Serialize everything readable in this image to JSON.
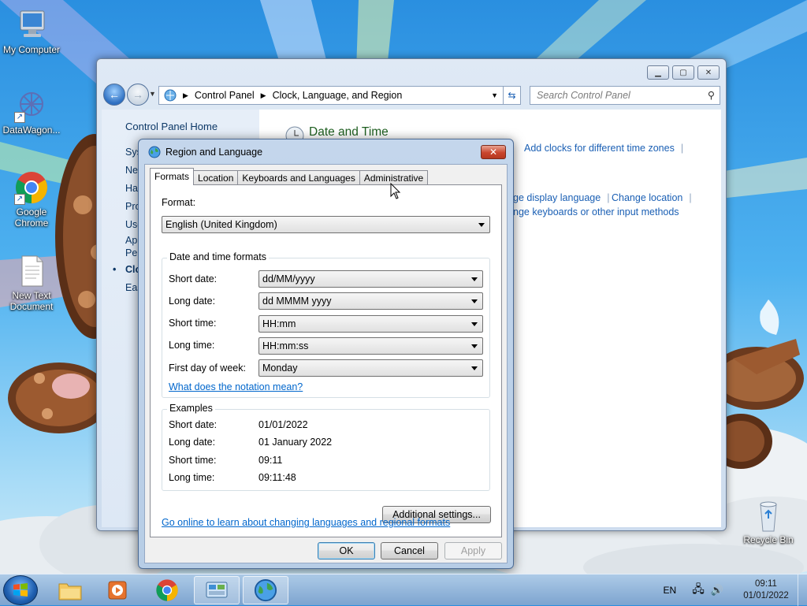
{
  "desktop": {
    "icons": [
      {
        "label": "My Computer"
      },
      {
        "label": "DataWagon..."
      },
      {
        "label": "Google Chrome"
      },
      {
        "label": "New Text Document"
      },
      {
        "label": "Recycle Bin"
      }
    ]
  },
  "control_panel": {
    "breadcrumb": [
      "Control Panel",
      "Clock, Language, and Region"
    ],
    "search_placeholder": "Search Control Panel",
    "left_nav": {
      "home": "Control Panel Home",
      "items": [
        "Sys",
        "Net",
        "Ha",
        "Pro",
        "Use",
        "Ap",
        "Per",
        "Clo",
        "Eas"
      ],
      "current": "Clo"
    },
    "section_title": "Date and Time",
    "links": {
      "add_clocks": "Add clocks for different time zones",
      "change_display_language": "ge display language",
      "change_location": "Change location",
      "change_keyboards": "nge keyboards or other input methods"
    }
  },
  "dialog": {
    "title": "Region and Language",
    "close_glyph": "✕",
    "tabs": [
      "Formats",
      "Location",
      "Keyboards and Languages",
      "Administrative"
    ],
    "active_tab": "Formats",
    "format_label": "Format:",
    "format_value": "English (United Kingdom)",
    "dt_group_title": "Date and time formats",
    "rows": [
      {
        "label": "Short date:",
        "value": "dd/MM/yyyy"
      },
      {
        "label": "Long date:",
        "value": "dd MMMM yyyy"
      },
      {
        "label": "Short time:",
        "value": "HH:mm"
      },
      {
        "label": "Long time:",
        "value": "HH:mm:ss"
      },
      {
        "label": "First day of week:",
        "value": "Monday"
      }
    ],
    "notation_link": "What does the notation mean?",
    "examples_title": "Examples",
    "examples": [
      {
        "label": "Short date:",
        "value": "01/01/2022"
      },
      {
        "label": "Long date:",
        "value": "01 January 2022"
      },
      {
        "label": "Short time:",
        "value": "09:11"
      },
      {
        "label": "Long time:",
        "value": "09:11:48"
      }
    ],
    "additional_settings": "Additional settings...",
    "online_link": "Go online to learn about changing languages and regional formats",
    "buttons": {
      "ok": "OK",
      "cancel": "Cancel",
      "apply": "Apply"
    }
  },
  "taskbar": {
    "language": "EN",
    "time": "09:11",
    "date": "01/01/2022"
  },
  "colors": {
    "link": "#1a5fb4",
    "dialog_link": "#0066cc",
    "section_title": "#1e5f20"
  }
}
